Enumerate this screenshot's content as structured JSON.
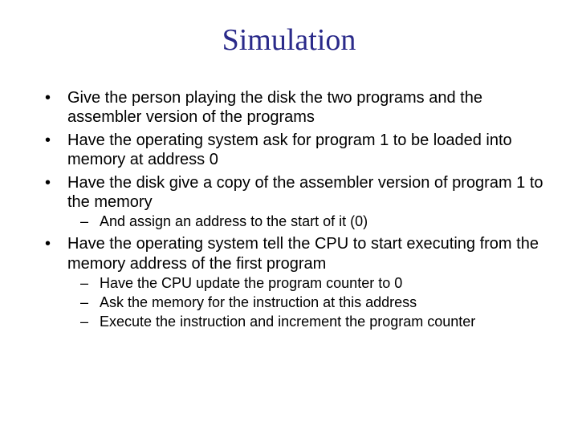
{
  "title": "Simulation",
  "bullets": [
    {
      "text": "Give the person playing the disk the two programs and the assembler version of the programs",
      "sub": []
    },
    {
      "text": "Have the operating system ask for program 1 to be loaded into memory at address 0",
      "sub": []
    },
    {
      "text": "Have the disk give a copy of the assembler version of program 1 to the memory",
      "sub": [
        "And assign an address to the start of it (0)"
      ]
    },
    {
      "text": "Have the operating system tell the CPU to start executing from the memory address of the first program",
      "sub": [
        "Have the CPU update the program counter to 0",
        "Ask the memory for the instruction at this address",
        "Execute the instruction and increment the program counter"
      ]
    }
  ]
}
